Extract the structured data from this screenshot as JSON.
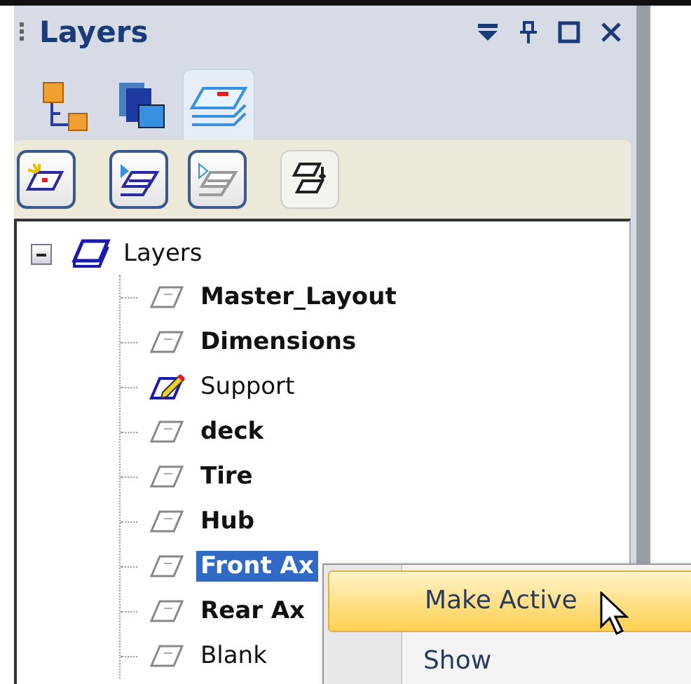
{
  "panel": {
    "title": "Layers"
  },
  "tabs": [
    {
      "kind": "tree",
      "selected": false
    },
    {
      "kind": "pages",
      "selected": false
    },
    {
      "kind": "layers",
      "selected": true
    }
  ],
  "toolbar": [
    {
      "kind": "new",
      "disabled": false
    },
    {
      "kind": "show",
      "disabled": false
    },
    {
      "kind": "hide",
      "disabled": false
    },
    {
      "kind": "move",
      "disabled": false
    }
  ],
  "tree": {
    "label": "Layers",
    "expanded": true,
    "children": [
      {
        "label": "Master_Layout",
        "kind": "layer",
        "bold": true,
        "selected": false
      },
      {
        "label": "Dimensions",
        "kind": "layer",
        "bold": true,
        "selected": false
      },
      {
        "label": "Support",
        "kind": "active",
        "bold": false,
        "selected": false
      },
      {
        "label": "deck",
        "kind": "layer",
        "bold": true,
        "selected": false
      },
      {
        "label": "Tire",
        "kind": "layer",
        "bold": true,
        "selected": false
      },
      {
        "label": "Hub",
        "kind": "layer",
        "bold": true,
        "selected": false
      },
      {
        "label": "Front Ax",
        "kind": "layer",
        "bold": true,
        "selected": true
      },
      {
        "label": "Rear Ax",
        "kind": "layer",
        "bold": true,
        "selected": false
      },
      {
        "label": "Blank",
        "kind": "layer",
        "bold": false,
        "selected": false
      }
    ]
  },
  "context_menu": [
    {
      "label": "Make Active",
      "selected": true
    },
    {
      "label": "Show",
      "selected": false
    }
  ]
}
